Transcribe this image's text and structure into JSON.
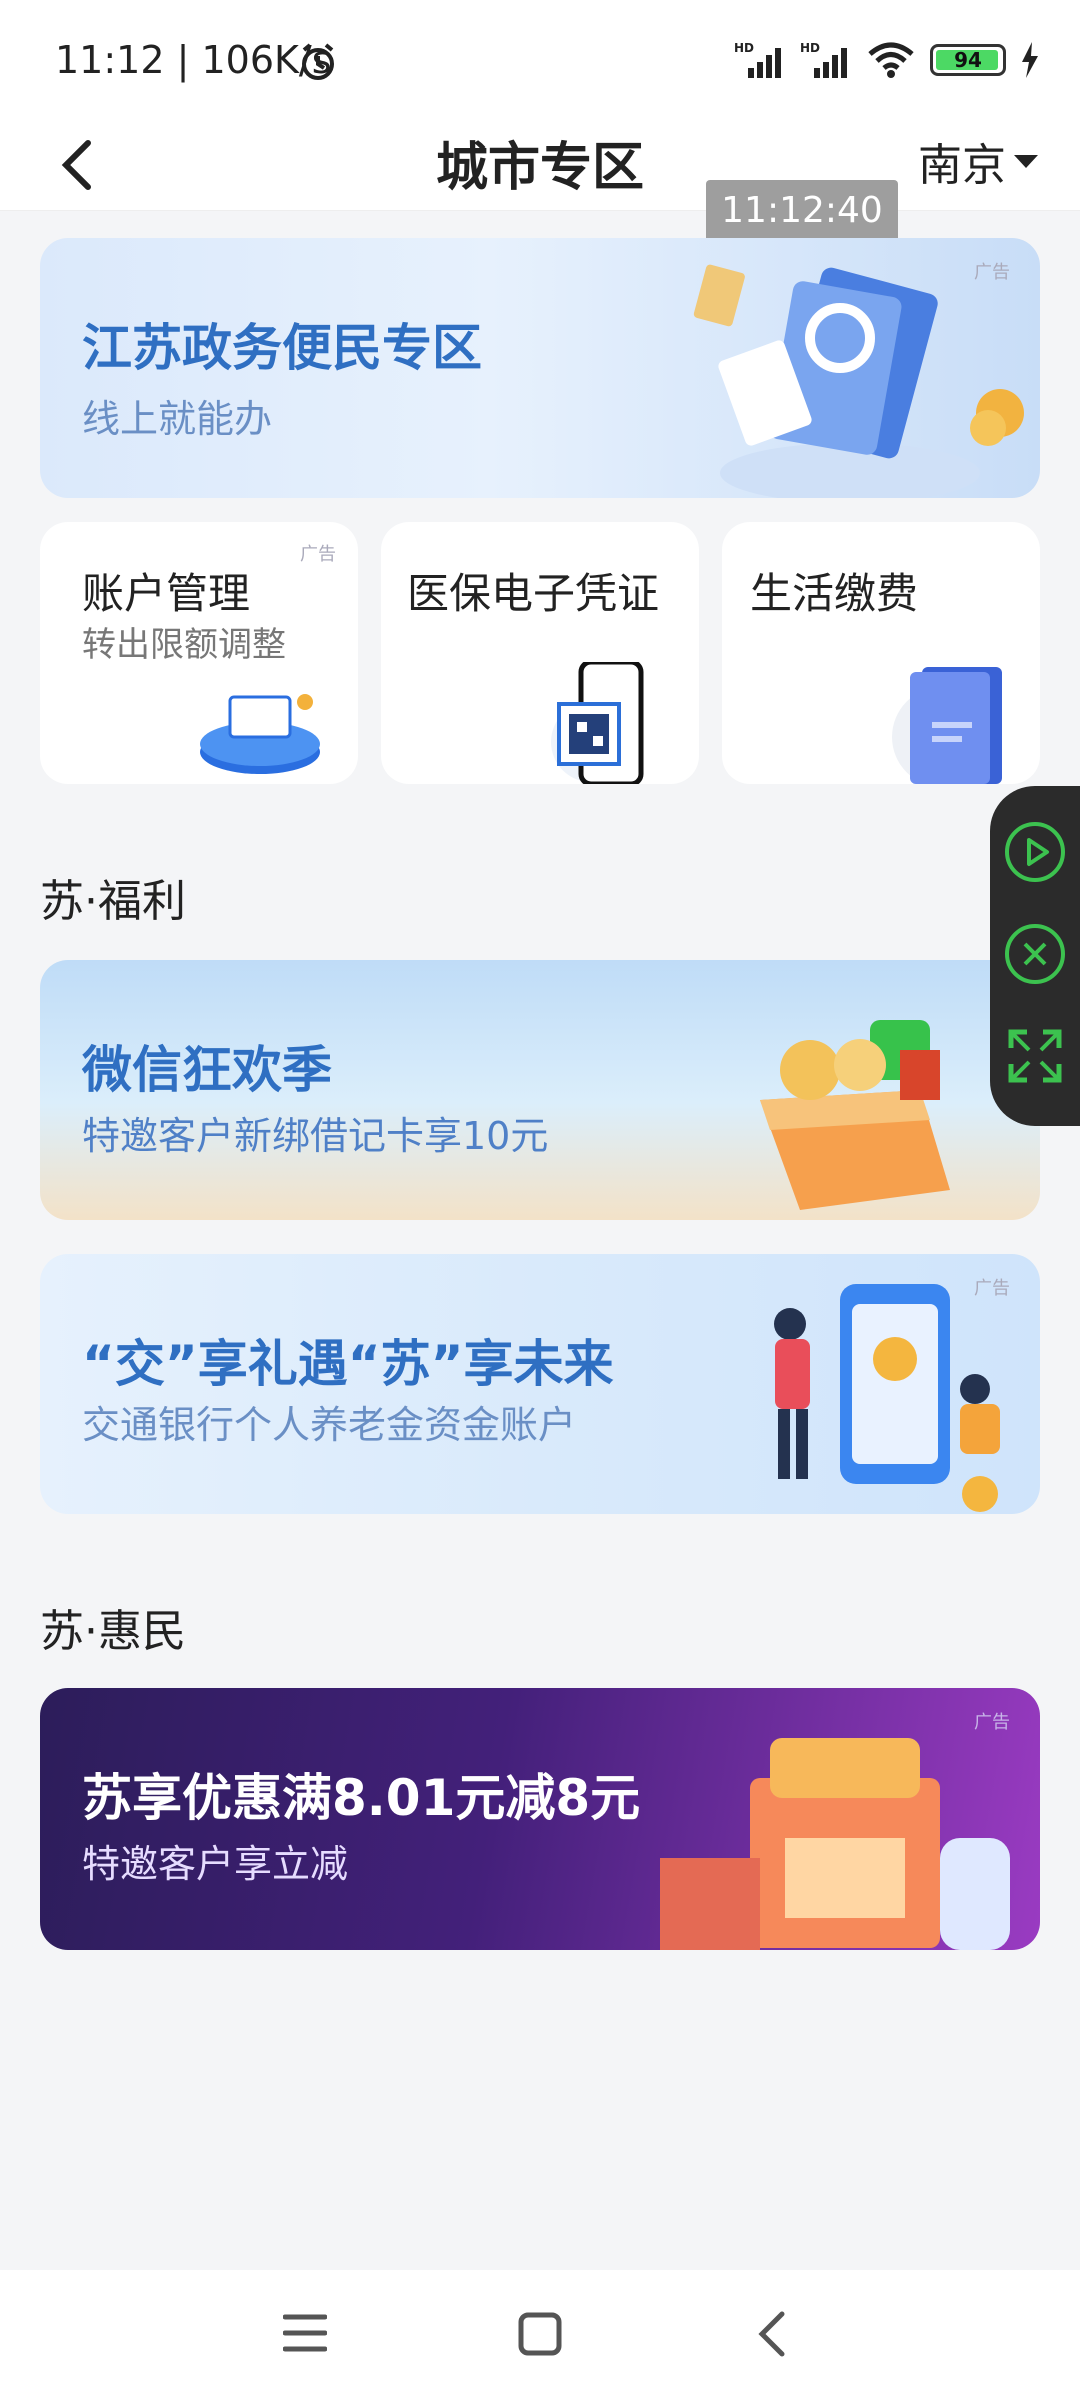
{
  "status_bar": {
    "time": "11:12 | 106K/s",
    "battery": "94"
  },
  "header": {
    "title": "城市专区",
    "city": "南京"
  },
  "tooltip_time": "11:12:40",
  "banners": {
    "gov": {
      "title": "江苏政务便民专区",
      "subtitle": "线上就能办",
      "ad": "广告"
    },
    "wechat": {
      "title": "微信狂欢季",
      "subtitle": "特邀客户新绑借记卡享10元"
    },
    "pension": {
      "title": "“交”享礼遇“苏”享未来",
      "subtitle": "交通银行个人养老金资金账户",
      "ad": "广告"
    },
    "discount": {
      "title": "苏享优惠满8.01元减8元",
      "subtitle": "特邀客户享立减",
      "ad": "广告"
    }
  },
  "tiles": [
    {
      "title": "账户管理",
      "subtitle": "转出限额调整",
      "ad": "广告"
    },
    {
      "title": "医保电子凭证"
    },
    {
      "title": "生活缴费"
    }
  ],
  "sections": {
    "welfare": "苏·福利",
    "benefit": "苏·惠民"
  },
  "colors": {
    "accent_green": "#3cc24f",
    "float_bg": "#2b2b2b",
    "banner_blue_text": "#2f6fc2"
  }
}
